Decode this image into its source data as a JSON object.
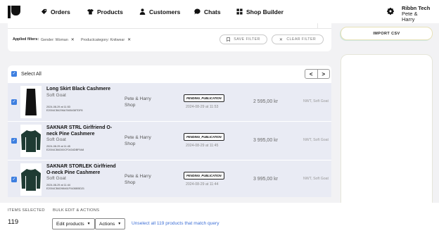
{
  "nav": {
    "items": [
      {
        "label": "Orders",
        "icon": "tag-icon"
      },
      {
        "label": "Products",
        "icon": "shirt-icon"
      },
      {
        "label": "Customers",
        "icon": "person-icon"
      },
      {
        "label": "Chats",
        "icon": "chat-icon"
      },
      {
        "label": "Shop Builder",
        "icon": "grid-icon"
      }
    ],
    "account_line1": "Ribbn Tech",
    "account_line2": "Pete & Harry"
  },
  "filters": {
    "label": "Applied filters:",
    "chips": [
      "Gender: Woman",
      "Productcategory: Knitwear"
    ],
    "save_label": "SAVE FILTER",
    "clear_label": "CLEAR FILTER"
  },
  "list": {
    "select_all_label": "Select All",
    "pager_prev": "<",
    "pager_next": ">",
    "rows": [
      {
        "title": "Long Skirt Black Cashmere",
        "brand": "Soft Goat",
        "date": "2024-08-29 at 11:53",
        "id": "E2004CB4296A7665438TDF8",
        "shop": "Pete & Harry Shop",
        "status": "PENDING_PUBLICATION",
        "status_date": "2024-08-29 at 11:53",
        "price": "2 595,00 kr",
        "condition": "NWT, Soft Goat"
      },
      {
        "title": "SAKNAR STRL Girlfriend O-neck Pine Cashmere",
        "brand": "Soft Goat",
        "date": "2024-08-29 at 11:45",
        "id": "E2004CB4D00CF0434DBF9A8",
        "shop": "Pete & Harry Shop",
        "status": "PENDING_PUBLICATION",
        "status_date": "2024-08-29 at 11:45",
        "price": "3 995,00 kr",
        "condition": "NWT, Soft Goat"
      },
      {
        "title": "SAKNAR STORLEK Girlfriend O-neck Pine Cashmere",
        "brand": "Soft Goat",
        "date": "2024-08-29 at 11:44",
        "id": "E2004CB4D98461F0436B5D21",
        "shop": "Pete & Harry Shop",
        "status": "PENDING_PUBLICATION",
        "status_date": "2024-08-29 at 11:44",
        "price": "3 995,00 kr",
        "condition": "NWT, Soft Goat"
      }
    ]
  },
  "sidebar": {
    "import_label": "IMPORT CSV"
  },
  "bottom": {
    "items_selected_label": "ITEMS SELECTED",
    "bulk_label": "BULK EDIT & ACTIONS",
    "count": "119",
    "edit_products_label": "Edit products",
    "actions_label": "Actions",
    "unselect_label": "Unselect all 119 products that match query"
  },
  "colors": {
    "accent": "#3d7fe0",
    "row_bg": "#e9ebf4",
    "link": "#3d6fd6"
  }
}
